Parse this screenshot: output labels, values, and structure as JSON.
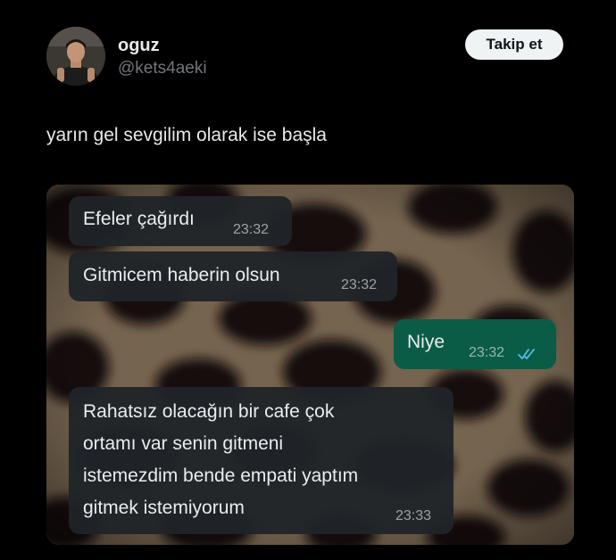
{
  "tweet": {
    "author_name": "oguz",
    "author_handle": "@kets4aeki",
    "follow_label": "Takip et",
    "text": "yarın gel sevgilim olarak ise başla"
  },
  "chat": {
    "messages": [
      {
        "direction": "incoming",
        "text": "Efeler çağırdı",
        "time": "23:32"
      },
      {
        "direction": "incoming",
        "text": "Gitmicem haberin olsun",
        "time": "23:32"
      },
      {
        "direction": "outgoing",
        "text": "Niye",
        "time": "23:32",
        "status": "read"
      },
      {
        "direction": "incoming",
        "lines": [
          "Rahatsız olacağın bir cafe çok",
          "ortamı var senin gitmeni",
          "istemezdim bende empati yaptım",
          "gitmek istemiyorum"
        ],
        "time": "23:33"
      }
    ]
  },
  "colors": {
    "incoming_bubble": "#202428",
    "outgoing_bubble": "#0b5c46",
    "read_ticks": "#53bdeb",
    "follow_button_bg": "#eff3f4"
  },
  "icons": {
    "read_status": "double-check-icon"
  }
}
